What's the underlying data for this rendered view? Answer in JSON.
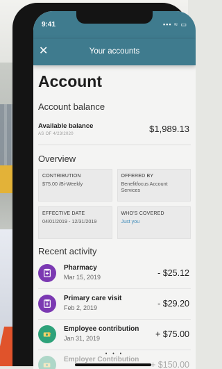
{
  "status_bar": {
    "time": "9:41",
    "indicators": "▪▪▪ ≈ ▭"
  },
  "nav": {
    "title": "Your accounts",
    "close_icon": "close-icon"
  },
  "page_title": "Account",
  "balance": {
    "section_title": "Account balance",
    "label": "Available balance",
    "as_of": "AS OF 4/23/2020",
    "value": "$1,989.13"
  },
  "overview": {
    "section_title": "Overview",
    "cards": [
      {
        "key": "CONTRIBUTION",
        "value": "$75.00 /Bi-Weekly"
      },
      {
        "key": "OFFERED BY",
        "value": "Benefitfocus Account Services"
      },
      {
        "key": "EFFECTIVE DATE",
        "value": "04/01/2019 - 12/31/2019"
      },
      {
        "key": "WHO'S COVERED",
        "value": "Just you"
      }
    ]
  },
  "recent": {
    "section_title": "Recent activity",
    "items": [
      {
        "name": "Pharmacy",
        "date": "Mar 15, 2019",
        "amount": "- $25.12",
        "icon": "pharmacy-icon",
        "color": "#7b39b2"
      },
      {
        "name": "Primary care visit",
        "date": "Feb 2, 2019",
        "amount": "- $29.20",
        "icon": "medical-icon",
        "color": "#7b39b2"
      },
      {
        "name": "Employee contribution",
        "date": "Jan 31, 2019",
        "amount": "+ $75.00",
        "icon": "money-icon",
        "color": "#2ea27a"
      },
      {
        "name": "Employer Contribution",
        "date": "",
        "amount": "+ $150.00",
        "icon": "money-icon",
        "color": "#2ea27a"
      }
    ]
  },
  "page_dots": "• • •"
}
